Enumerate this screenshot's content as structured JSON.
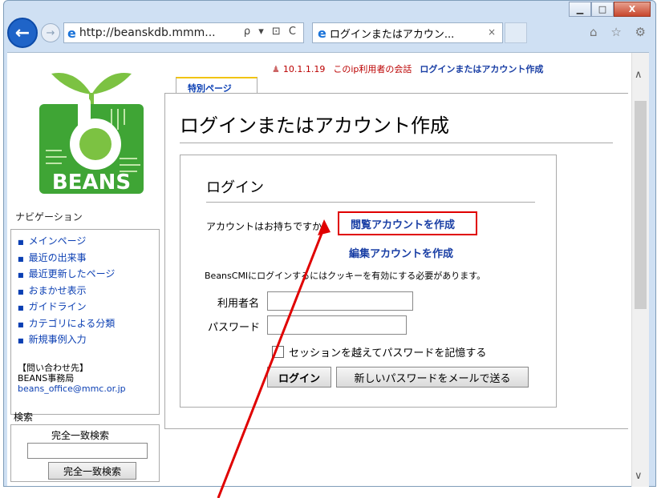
{
  "browser": {
    "address": "http://beanskdb.mmm...",
    "address_tools": "ρ ▾ ⊡ C",
    "tab_title": "ログインまたはアカウン...",
    "tab_close": "×",
    "toolbar_icons": "⌂ ☆ ⚙",
    "win_minimize": "▁",
    "win_maximize": "□",
    "win_close": "X"
  },
  "personal": {
    "ip": "10.1.1.19",
    "talk": "このip利用者の会話",
    "create": "ログインまたはアカウント作成"
  },
  "sidebar": {
    "nav_heading": "ナビゲーション",
    "items": [
      {
        "label": "メインページ"
      },
      {
        "label": "最近の出来事"
      },
      {
        "label": "最近更新したページ"
      },
      {
        "label": "おまかせ表示"
      },
      {
        "label": "ガイドライン"
      },
      {
        "label": "カテゴリによる分類"
      },
      {
        "label": "新規事例入力"
      }
    ],
    "contact_line1": "【問い合わせ先】",
    "contact_line2": "BEANS事務局",
    "contact_email": "beans_office@mmc.or.jp",
    "search_heading": "検索",
    "search_label": "完全一致検索",
    "search_button": "完全一致検索"
  },
  "content": {
    "special_tab": "特別ページ",
    "title": "ログインまたはアカウント作成",
    "login_heading": "ログイン",
    "have_account": "アカウントはお持ちですか?",
    "create_view": "閲覧アカウントを作成",
    "create_edit": "編集アカウントを作成",
    "cookie_note": "BeansCMIにログインするにはクッキーを有効にする必要があります。",
    "username_label": "利用者名",
    "password_label": "パスワード",
    "remember_label": "セッションを越えてパスワードを記憶する",
    "login_button": "ログイン",
    "mail_button": "新しいパスワードをメールで送る"
  },
  "logo": {
    "text": "BEANS"
  },
  "colors": {
    "link": "#0b3fb3",
    "highlight": "#e00000",
    "logo_green": "#3fa535"
  }
}
